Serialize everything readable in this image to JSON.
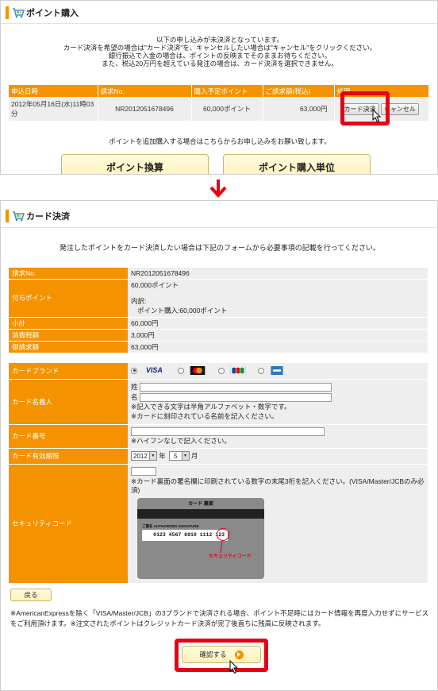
{
  "top": {
    "title": "ポイント購入",
    "notice": [
      "以下の申し込みが未決済となっています。",
      "カード決済を希望の場合は\"カード決済\"を、キャンセルしたい場合は\"キャンセル\"をクリックください。",
      "銀行振込で入金の場合は、ポイントの反映までそのままお待ちください。",
      "また、税込20万円を超えている発注の場合は、カード決済を選択できません。"
    ],
    "table": {
      "headers": [
        "申込日時",
        "請求No.",
        "購入予定ポイント",
        "ご請求額(税込)",
        "処理"
      ],
      "row": {
        "date": "2012年05月16日(水)11時03分",
        "invoice": "NR2012051678496",
        "points": "60,000ポイント",
        "amount": "63,000円",
        "card_button": "カード決済",
        "cancel_button": "キャンセル"
      }
    },
    "info": "ポイントを追加購入する場合はこちらからお申し込みをお願い致します。",
    "exchange_button": "ポイント換算",
    "unit_button": "ポイント購入単位"
  },
  "bottom": {
    "title": "カード決済",
    "lead": "発注したポイントをカード決済したい場合は下記のフォームから必要事項の記載を行ってください。",
    "summary": [
      {
        "label": "請求No.",
        "value": "NR2012051678496"
      },
      {
        "label": "付与ポイント",
        "value": "60,000ポイント",
        "detail_title": "内訳:",
        "detail": "ポイント購入:60,000ポイント"
      },
      {
        "label": "小計",
        "value": "60,000円"
      },
      {
        "label": "消費税額",
        "value": "3,000円"
      },
      {
        "label": "御請求額",
        "value": "63,000円"
      }
    ],
    "form": {
      "brand_label": "カードブランド",
      "brands": [
        "VISA",
        "MasterCard",
        "JCB",
        "AMEX"
      ],
      "name_label": "カード名義人",
      "last_name_label": "姓",
      "first_name_label": "名",
      "name_note1": "※記入できる文字は半角アルファベット・数字です。",
      "name_note2": "※カードに刻印されている名前を記入ください。",
      "number_label": "カード番号",
      "number_note": "※ハイフンなしで記入ください。",
      "expiry_label": "カード有効期限",
      "expiry_year": "2012",
      "year_unit": "年",
      "expiry_month": "5",
      "month_unit": "月",
      "security_label": "セキュリティコード",
      "security_note": "※カード裏面の署名欄に印刷されている数字の末尾3桁を記入ください。(VISA/Master/JCBのみ必須)",
      "card_back_title": "カード 裏面",
      "signature_text": "ご署名 AUTHORIZED SIGNATURE",
      "card_digits": "0123 4567 8910 1112",
      "card_cvv": "123",
      "callout": "セキュリティコード"
    },
    "back_button": "戻る",
    "footnote": "※AmericanExpressを除く「VISA/Master/JCB」の3ブランドで決済される場合、ポイント不足時にはカード情報を再度入力せずにサービスをご利用頂けます。※注文されたポイントはクレジットカード決済が完了後直ちに残高に反映されます。",
    "confirm_button": "確認する"
  },
  "colors": {
    "accent": "#f49200",
    "highlight": "#e60012",
    "row_bg": "#eeeeee"
  }
}
